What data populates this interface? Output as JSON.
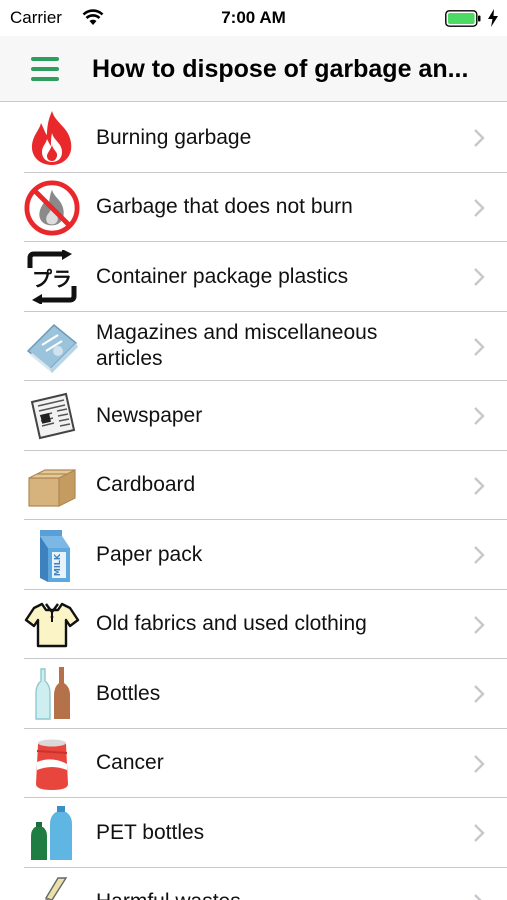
{
  "status_bar": {
    "carrier": "Carrier",
    "time": "7:00 AM",
    "battery_color": "#4cd964"
  },
  "nav": {
    "title": "How to dispose of garbage an...",
    "accent": "#2e9e5f"
  },
  "items": [
    {
      "label": "Burning garbage",
      "icon": "fire-icon"
    },
    {
      "label": "Garbage that does not burn",
      "icon": "no-burn-icon"
    },
    {
      "label": "Container package plastics",
      "icon": "plastic-recycle-icon"
    },
    {
      "label": "Magazines and miscellaneous articles",
      "icon": "magazine-icon"
    },
    {
      "label": "Newspaper",
      "icon": "newspaper-icon"
    },
    {
      "label": "Cardboard",
      "icon": "cardboard-box-icon"
    },
    {
      "label": "Paper pack",
      "icon": "milk-carton-icon"
    },
    {
      "label": "Old fabrics and used clothing",
      "icon": "shirt-icon"
    },
    {
      "label": "Bottles",
      "icon": "bottles-icon"
    },
    {
      "label": "Cancer",
      "icon": "can-icon"
    },
    {
      "label": "PET bottles",
      "icon": "pet-bottles-icon"
    },
    {
      "label": "Harmful wastes",
      "icon": "harmful-waste-icon"
    }
  ]
}
